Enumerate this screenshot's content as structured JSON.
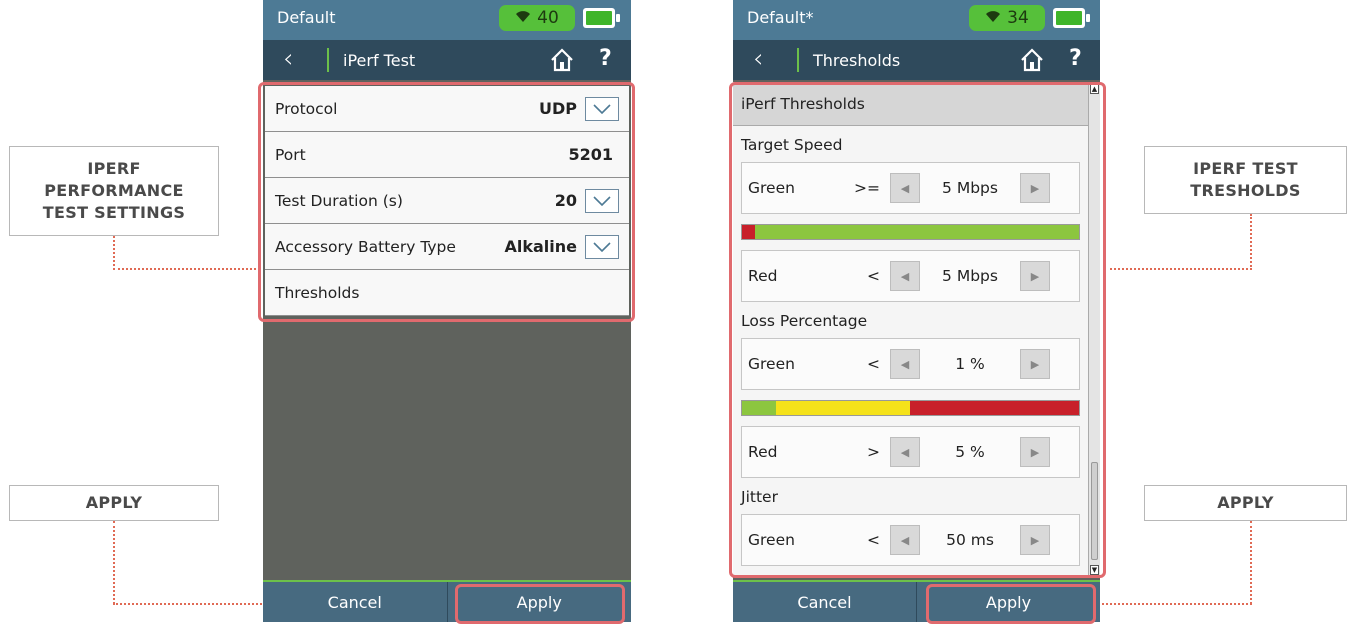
{
  "callouts": {
    "left_settings": [
      "IPERF",
      "PERFORMANCE",
      "TEST SETTINGS"
    ],
    "left_apply": "APPLY",
    "right_thresholds": [
      "IPERF TEST",
      "TRESHOLDS"
    ],
    "right_apply": "APPLY"
  },
  "left_screen": {
    "profile": "Default",
    "wifi_signal": "40",
    "nav_title": "iPerf Test",
    "help": "?",
    "rows": [
      {
        "label": "Protocol",
        "value": "UDP"
      },
      {
        "label": "Port",
        "value": "5201"
      },
      {
        "label": "Test Duration (s)",
        "value": "20"
      },
      {
        "label": "Accessory Battery Type",
        "value": "Alkaline"
      },
      {
        "label": "Thresholds",
        "value": ""
      }
    ],
    "cancel": "Cancel",
    "apply": "Apply"
  },
  "right_screen": {
    "profile": "Default*",
    "wifi_signal": "34",
    "nav_title": "Thresholds",
    "help": "?",
    "header": "iPerf Thresholds",
    "sections": [
      {
        "title": "Target Speed",
        "green": {
          "label": "Green",
          "op": ">=",
          "value": "5 Mbps"
        },
        "red": {
          "label": "Red",
          "op": "<",
          "value": "5 Mbps"
        },
        "bar": [
          {
            "color": "#c8202a",
            "fraction": 0.04
          },
          {
            "color": "#8cc63f",
            "fraction": 0.96
          }
        ]
      },
      {
        "title": "Loss Percentage",
        "green": {
          "label": "Green",
          "op": "<",
          "value": "1 %"
        },
        "red": {
          "label": "Red",
          "op": ">",
          "value": "5 %"
        },
        "bar": [
          {
            "color": "#8cc63f",
            "fraction": 0.1
          },
          {
            "color": "#f5e21a",
            "fraction": 0.4
          },
          {
            "color": "#c8202a",
            "fraction": 0.5
          }
        ]
      },
      {
        "title": "Jitter",
        "green": {
          "label": "Green",
          "op": "<",
          "value": "50 ms"
        },
        "bar": [
          {
            "color": "#8cc63f",
            "fraction": 0.08
          },
          {
            "color": "#f5e21a",
            "fraction": 0.1
          },
          {
            "color": "#c8202a",
            "fraction": 0.82
          }
        ]
      }
    ],
    "cancel": "Cancel",
    "apply": "Apply"
  },
  "colors": {
    "status_bar": "#4d7a95",
    "nav_bar": "#2f4a5c",
    "wifi_badge": "#56c03a",
    "highlight": "#e06a6e",
    "callout_line": "#e06a55"
  },
  "icons": [
    "wifi-icon",
    "battery-icon",
    "back-chevron-icon",
    "home-icon",
    "help-icon",
    "dropdown-chevron-icon",
    "arrow-left-icon",
    "arrow-right-icon"
  ]
}
